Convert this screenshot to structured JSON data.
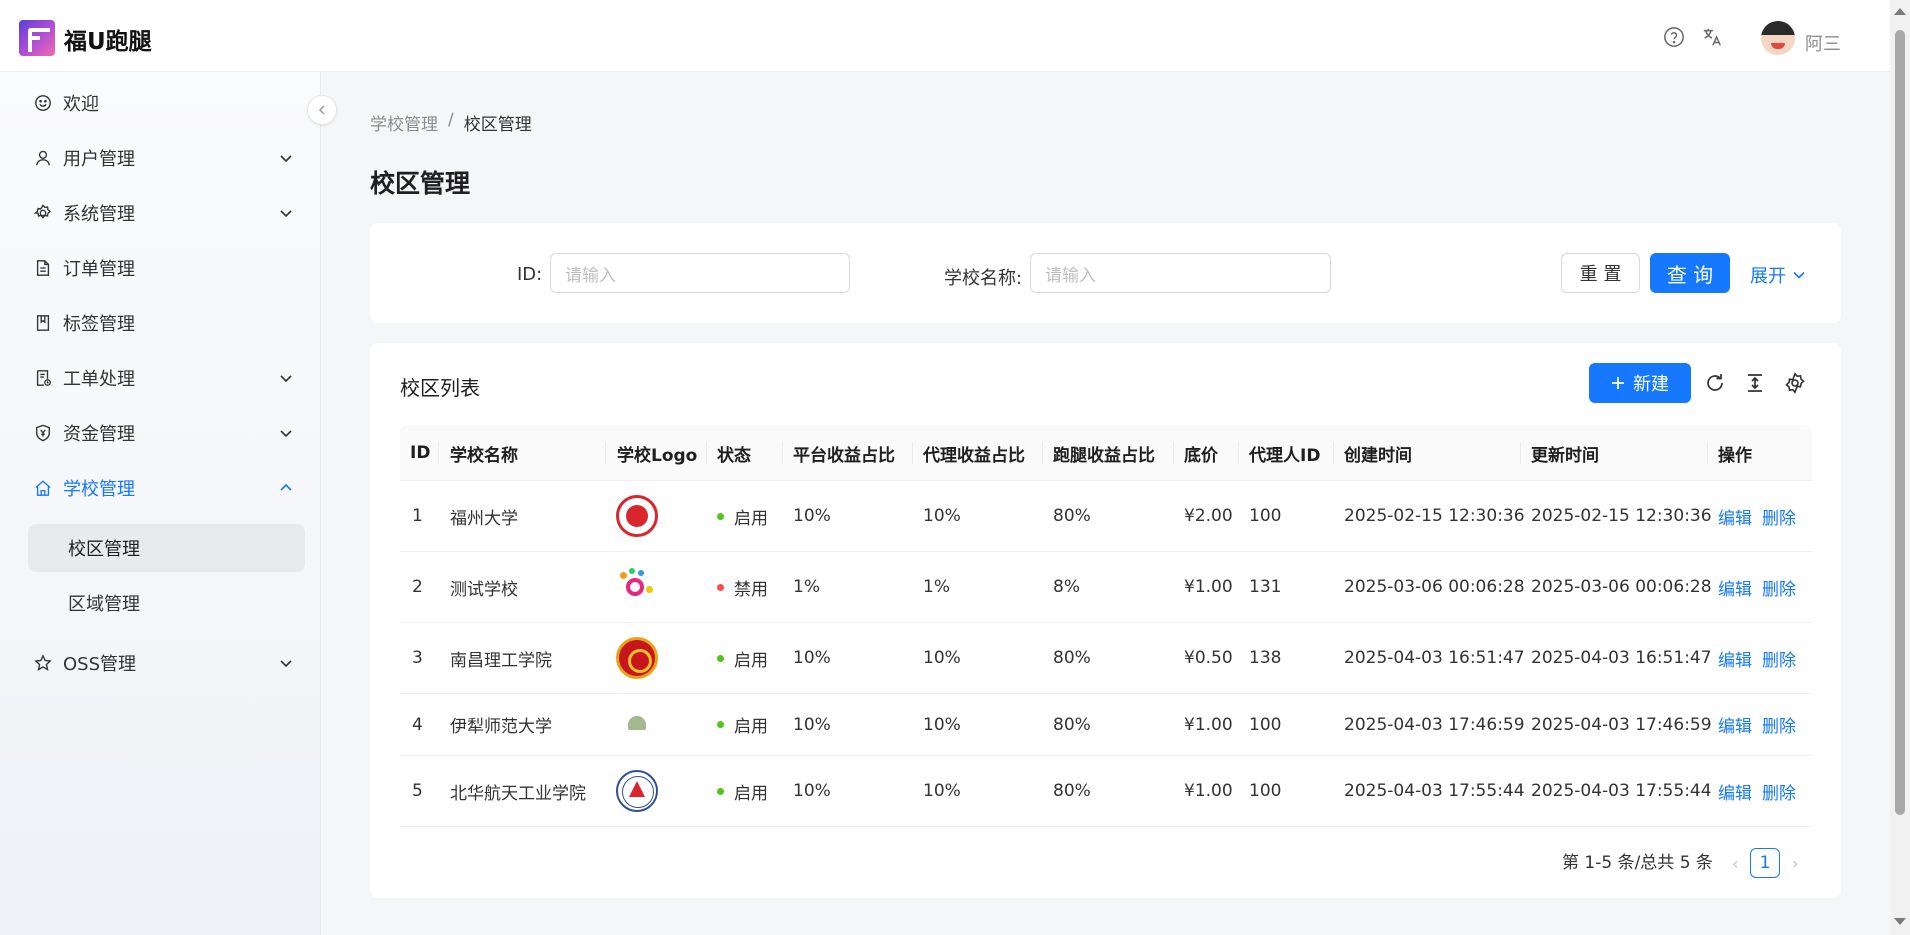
{
  "app": {
    "title": "福U跑腿",
    "username": "阿三"
  },
  "sidebar": {
    "items": [
      {
        "label": "欢迎",
        "icon": "smile-icon",
        "expandable": false
      },
      {
        "label": "用户管理",
        "icon": "user-icon",
        "expandable": true
      },
      {
        "label": "系统管理",
        "icon": "gear-icon",
        "expandable": true
      },
      {
        "label": "订单管理",
        "icon": "file-icon",
        "expandable": false
      },
      {
        "label": "标签管理",
        "icon": "book-icon",
        "expandable": false
      },
      {
        "label": "工单处理",
        "icon": "ticket-icon",
        "expandable": true
      },
      {
        "label": "资金管理",
        "icon": "shield-yen-icon",
        "expandable": true
      },
      {
        "label": "学校管理",
        "icon": "home-icon",
        "expandable": true,
        "active": true
      },
      {
        "label": "OSS管理",
        "icon": "star-icon",
        "expandable": true
      }
    ],
    "school_submenu": [
      {
        "label": "校区管理",
        "selected": true
      },
      {
        "label": "区域管理",
        "selected": false
      }
    ]
  },
  "breadcrumb": {
    "parent": "学校管理",
    "separator": "/",
    "current": "校区管理"
  },
  "page_title": "校区管理",
  "search": {
    "id_label": "ID:",
    "id_placeholder": "请输入",
    "name_label": "学校名称:",
    "name_placeholder": "请输入",
    "reset_label": "重 置",
    "query_label": "查 询",
    "expand_label": "展开"
  },
  "table": {
    "title": "校区列表",
    "new_label": "新建",
    "columns": [
      "ID",
      "学校名称",
      "学校Logo",
      "状态",
      "平台收益占比",
      "代理收益占比",
      "跑腿收益占比",
      "底价",
      "代理人ID",
      "创建时间",
      "更新时间",
      "操作"
    ],
    "rows": [
      {
        "id": "1",
        "name": "福州大学",
        "logo": "fuzhou",
        "status": "启用",
        "enabled": true,
        "platform": "10%",
        "agent": "10%",
        "runner": "80%",
        "price": "¥2.00",
        "agent_id": "100",
        "created": "2025-02-15 12:30:36",
        "updated": "2025-02-15 12:30:36"
      },
      {
        "id": "2",
        "name": "测试学校",
        "logo": "test",
        "status": "禁用",
        "enabled": false,
        "platform": "1%",
        "agent": "1%",
        "runner": "8%",
        "price": "¥1.00",
        "agent_id": "131",
        "created": "2025-03-06 00:06:28",
        "updated": "2025-03-06 00:06:28"
      },
      {
        "id": "3",
        "name": "南昌理工学院",
        "logo": "nanchang",
        "status": "启用",
        "enabled": true,
        "platform": "10%",
        "agent": "10%",
        "runner": "80%",
        "price": "¥0.50",
        "agent_id": "138",
        "created": "2025-04-03 16:51:47",
        "updated": "2025-04-03 16:51:47"
      },
      {
        "id": "4",
        "name": "伊犁师范大学",
        "logo": "yili",
        "status": "启用",
        "enabled": true,
        "platform": "10%",
        "agent": "10%",
        "runner": "80%",
        "price": "¥1.00",
        "agent_id": "100",
        "created": "2025-04-03 17:46:59",
        "updated": "2025-04-03 17:46:59"
      },
      {
        "id": "5",
        "name": "北华航天工业学院",
        "logo": "beihua",
        "status": "启用",
        "enabled": true,
        "platform": "10%",
        "agent": "10%",
        "runner": "80%",
        "price": "¥1.00",
        "agent_id": "100",
        "created": "2025-04-03 17:55:44",
        "updated": "2025-04-03 17:55:44"
      }
    ],
    "actions": {
      "edit": "编辑",
      "delete": "删除"
    }
  },
  "pagination": {
    "summary": "第 1-5 条/总共 5 条",
    "current_page": "1"
  },
  "colors": {
    "primary": "#1677ff",
    "enabled": "#52c41a",
    "disabled": "#ff4d4f"
  }
}
